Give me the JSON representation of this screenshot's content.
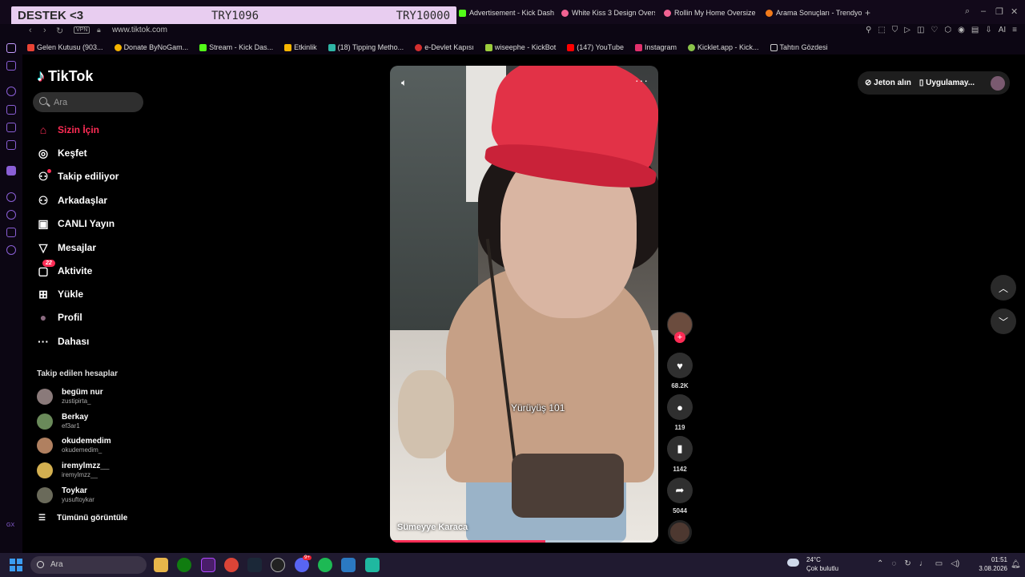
{
  "browser": {
    "donation": {
      "left": "DESTEK <3",
      "middle": "TRY1096",
      "right": "TRY10000"
    },
    "tabs": [
      {
        "label": "Advertisement - Kick Dash",
        "color": "#53fc18"
      },
      {
        "label": "White Kiss 3 Design Overs",
        "color": "#f06292"
      },
      {
        "label": "Rollin My Home Oversize T",
        "color": "#f06292"
      },
      {
        "label": "Arama Sonuçları - Trendyol",
        "color": "#f27a1a"
      }
    ],
    "new_tab": "+",
    "url": "www.tiktok.com",
    "vpn": "VPN",
    "ai_label": "AI",
    "bookmarks": [
      {
        "label": "Gelen Kutusu (903...",
        "color": "#ea4335"
      },
      {
        "label": "Donate ByNoGam...",
        "color": "#f5b400"
      },
      {
        "label": "Stream - Kick Das...",
        "color": "#53fc18"
      },
      {
        "label": "Etkinlik",
        "color": "#f7b500"
      },
      {
        "label": "(18) Tipping Metho...",
        "color": "#2fb5a5"
      },
      {
        "label": "e-Devlet Kapısı",
        "color": "#d32f2f"
      },
      {
        "label": "wiseephe - KickBot",
        "color": "#9ccc3c"
      },
      {
        "label": "(147) YouTube",
        "color": "#ff0000"
      },
      {
        "label": "Instagram",
        "color": "#e1306c"
      },
      {
        "label": "Kicklet.app - Kick...",
        "color": "#8bc34a"
      },
      {
        "label": "Tahtın Gözdesi",
        "color": "#cccccc"
      }
    ],
    "sidebar_gx": "GX"
  },
  "tiktok": {
    "logo": "TikTok",
    "search_placeholder": "Ara",
    "nav": [
      {
        "label": "Sizin İçin",
        "icon": "home-icon",
        "glyph": "⌂",
        "active": true
      },
      {
        "label": "Keşfet",
        "icon": "compass-icon",
        "glyph": "◎"
      },
      {
        "label": "Takip ediliyor",
        "icon": "following-icon",
        "glyph": "⚇"
      },
      {
        "label": "Arkadaşlar",
        "icon": "friends-icon",
        "glyph": "⚇"
      },
      {
        "label": "CANLI Yayın",
        "icon": "live-icon",
        "glyph": "▣"
      },
      {
        "label": "Mesajlar",
        "icon": "messages-icon",
        "glyph": "▽"
      },
      {
        "label": "Aktivite",
        "icon": "activity-icon",
        "glyph": "▢",
        "badge": "22"
      },
      {
        "label": "Yükle",
        "icon": "upload-icon",
        "glyph": "⊞"
      },
      {
        "label": "Profil",
        "icon": "profile-icon",
        "glyph": "●"
      },
      {
        "label": "Dahası",
        "icon": "more-icon",
        "glyph": "···"
      }
    ],
    "following_title": "Takip edilen hesaplar",
    "following": [
      {
        "name": "begüm nur",
        "user": "zustipirta_",
        "color": "#8a7a7a"
      },
      {
        "name": "Berkay",
        "user": "ef3ar1",
        "color": "#6a8a5a"
      },
      {
        "name": "okudemedim",
        "user": "okudemedim_",
        "color": "#b08060"
      },
      {
        "name": "iremylmzz__",
        "user": "iremylmzz__",
        "color": "#d4b050"
      },
      {
        "name": "Toykar",
        "user": "yusuftoykar",
        "color": "#6a6a5a"
      }
    ],
    "see_all": "Tümünü görüntüle",
    "video": {
      "caption": "Yürüyüş 101",
      "author": "Sümeyye Karaca",
      "progress": 0.58
    },
    "actions": {
      "likes": "68.2K",
      "comments": "119",
      "saves": "1142",
      "shares": "5044"
    },
    "topright": {
      "coins": "Jeton alın",
      "app": "Uygulamay..."
    }
  },
  "taskbar": {
    "search": "Ara",
    "weather_temp": "24°C",
    "weather_desc": "Çok bulutlu",
    "time": "01:51",
    "date": "3.08.2026",
    "discord_badge": "9+"
  }
}
